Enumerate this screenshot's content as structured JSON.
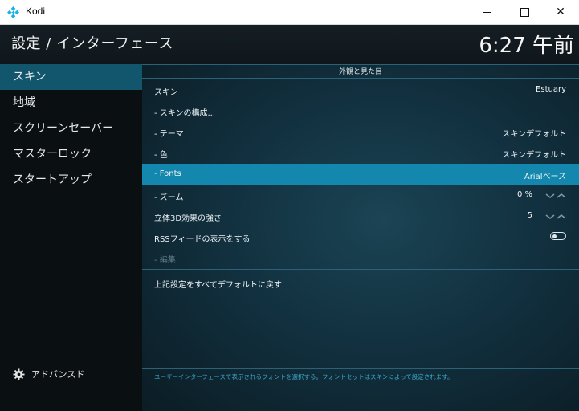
{
  "window": {
    "title": "Kodi"
  },
  "header": {
    "title": "設定 / インターフェース",
    "clock": "6:27 午前"
  },
  "sidebar": {
    "items": [
      {
        "label": "スキン",
        "active": true
      },
      {
        "label": "地域"
      },
      {
        "label": "スクリーンセーバー"
      },
      {
        "label": "マスターロック"
      },
      {
        "label": "スタートアップ"
      }
    ],
    "advanced_label": "アドバンスド"
  },
  "section": {
    "title": "外観と見た目"
  },
  "settings": [
    {
      "label": "スキン",
      "value": "Estuary"
    },
    {
      "label": "- スキンの構成...",
      "value": ""
    },
    {
      "label": "- テーマ",
      "value": "スキンデフォルト"
    },
    {
      "label": "- 色",
      "value": "スキンデフォルト"
    },
    {
      "label": "- Fonts",
      "value": "Arialベース",
      "active": true
    },
    {
      "label": "- ズーム",
      "value": "0 %"
    },
    {
      "label": "立体3D効果の強さ",
      "value": "5"
    },
    {
      "label": "RSSフィードの表示をする",
      "value": ""
    },
    {
      "label": "- 編集",
      "value": "",
      "disabled": true
    }
  ],
  "reset_label": "上記設定をすべてデフォルトに戻す",
  "help_text": "ユーザーインターフェースで表示されるフォントを選択する。フォントセットはスキンによって設定されます。",
  "colors": {
    "accent": "#1387ad",
    "sidebar_active": "#12566e",
    "help_text": "#3aa6c9"
  }
}
